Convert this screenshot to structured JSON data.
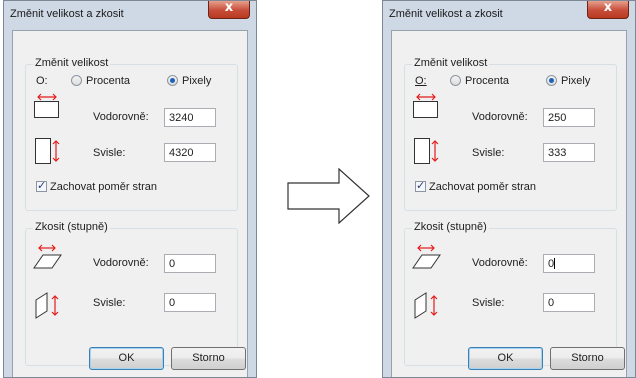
{
  "colors": {
    "arrow_red": "#e31b1b",
    "frame": "#cfd9e6",
    "dialog_bg": "#f0f0f0"
  },
  "left": {
    "title": "Změnit velikost a zkosit",
    "close_label": "x",
    "resize": {
      "group_label": "Změnit velikost",
      "by_label": "O:",
      "percent_label": "Procenta",
      "pixels_label": "Pixely",
      "horizontal_label": "Vodorovně:",
      "horizontal_value": "3240",
      "vertical_label": "Svisle:",
      "vertical_value": "4320",
      "aspect_label": "Zachovat poměr stran"
    },
    "skew": {
      "group_label": "Zkosit (stupně)",
      "horizontal_label": "Vodorovně:",
      "horizontal_value": "0",
      "vertical_label": "Svisle:",
      "vertical_value": "0"
    },
    "ok_label": "OK",
    "cancel_label": "Storno"
  },
  "right": {
    "title": "Změnit velikost a zkosit",
    "close_label": "x",
    "resize": {
      "group_label": "Změnit velikost",
      "by_label": "O:",
      "percent_label": "Procenta",
      "pixels_label": "Pixely",
      "horizontal_label": "Vodorovně:",
      "horizontal_value": "250",
      "vertical_label": "Svisle:",
      "vertical_value": "333",
      "aspect_label": "Zachovat poměr stran"
    },
    "skew": {
      "group_label": "Zkosit (stupně)",
      "horizontal_label": "Vodorovně:",
      "horizontal_value": "0",
      "vertical_label": "Svisle:",
      "vertical_value": "0"
    },
    "ok_label": "OK",
    "cancel_label": "Storno"
  }
}
